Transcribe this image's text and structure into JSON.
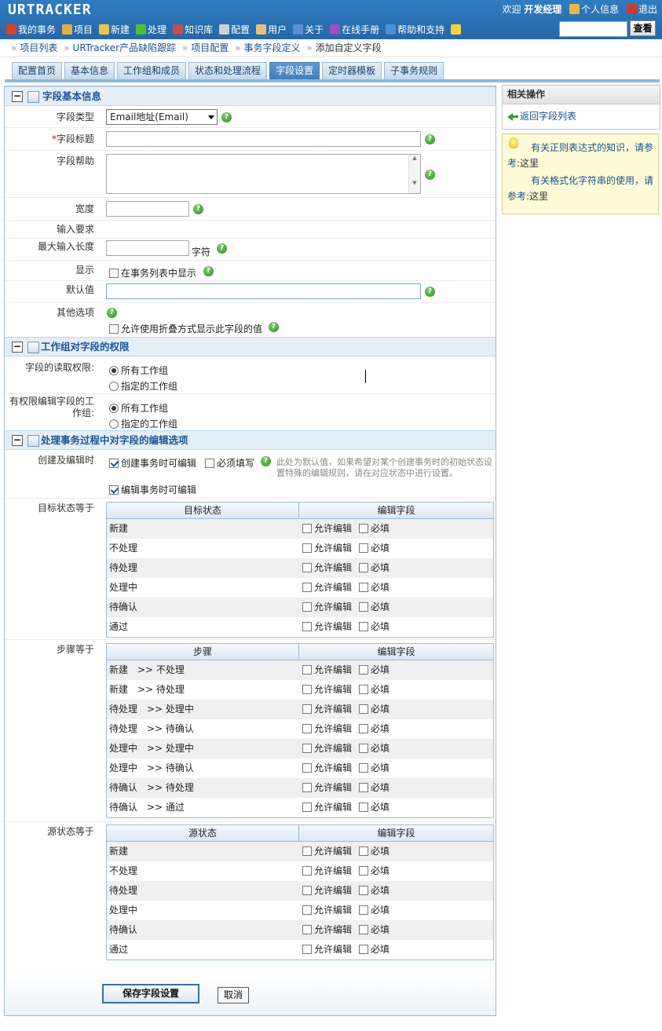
{
  "app": {
    "logo": "URTRACKER",
    "welcome_prefix": "欢迎",
    "user_name": "开发经理",
    "personal_info": "个人信息",
    "logout": "退出"
  },
  "menu": [
    {
      "label": "我的事务",
      "icon": "home-icon",
      "color": "#d9412b"
    },
    {
      "label": "项目",
      "icon": "database-icon",
      "color": "#e0b040"
    },
    {
      "label": "新建",
      "icon": "new-item-icon",
      "color": "#e8c64a"
    },
    {
      "label": "处理",
      "icon": "check-icon",
      "color": "#4cbf3a"
    },
    {
      "label": "知识库",
      "icon": "books-icon",
      "color": "#c0504d"
    },
    {
      "label": "配置",
      "icon": "gear-icon",
      "color": "#d0d0d0"
    },
    {
      "label": "用户",
      "icon": "users-icon",
      "color": "#e8c080"
    },
    {
      "label": "关于",
      "icon": "info-icon",
      "color": "#5a8fd6"
    },
    {
      "label": "在线手册",
      "icon": "manual-icon",
      "color": "#9b4fc2"
    },
    {
      "label": "帮助和支持",
      "icon": "help-icon",
      "color": "#4a8fe0"
    },
    {
      "label": "",
      "icon": "star-add-icon",
      "color": "#f2d33a"
    }
  ],
  "search": {
    "button": "查看",
    "value": ""
  },
  "breadcrumb": [
    "项目列表",
    "URTracker产品缺陷跟踪",
    "项目配置",
    "事务字段定义",
    "添加自定义字段"
  ],
  "tabs": [
    "配置首页",
    "基本信息",
    "工作组和成员",
    "状态和处理流程",
    "字段设置",
    "定时器模板",
    "子事务规则"
  ],
  "active_tab": 4,
  "section1": {
    "title": "字段基本信息",
    "field_type_label": "字段类型",
    "field_type_value": "Email地址(Email)",
    "field_title_label": "字段标题",
    "field_help_label": "字段帮助",
    "width_label": "宽度",
    "input_req_label": "输入要求",
    "max_len_label": "最大输入长度",
    "max_len_unit": "字符",
    "display_label": "显示",
    "display_option": "在事务列表中显示",
    "default_label": "默认值",
    "other_label": "其他选项",
    "other_option": "允许使用折叠方式显示此字段的值"
  },
  "section2": {
    "title": "工作组对字段的权限",
    "read_label": "字段的读取权限:",
    "edit_label": "有权限编辑字段的工作组:",
    "all_groups": "所有工作组",
    "specified_groups": "指定的工作组"
  },
  "section3": {
    "title": "处理事务过程中对字段的编辑选项",
    "create_edit_label": "创建及编辑时",
    "editable_on_create": "创建事务时可编辑",
    "required": "必须填写",
    "note": "此处为默认值，如果希望对某个创建事务时的初始状态设置特殊的编辑规则，请在对应状态中进行设置。",
    "editable_on_edit": "编辑事务时可编辑",
    "allow_edit": "允许编辑",
    "must_fill": "必填",
    "edit_field_header": "编辑字段",
    "target_label": "目标状态等于",
    "target_header": "目标状态",
    "target_rows": [
      "新建",
      "不处理",
      "待处理",
      "处理中",
      "待确认",
      "通过"
    ],
    "step_label": "步骤等于",
    "step_header": "步骤",
    "step_rows": [
      "新建　>> 不处理",
      "新建　>> 待处理",
      "待处理　>> 处理中",
      "待处理　>> 待确认",
      "处理中　>> 处理中",
      "处理中　>> 待确认",
      "待确认　>> 待处理",
      "待确认　>> 通过"
    ],
    "source_label": "源状态等于",
    "source_header": "源状态",
    "source_rows": [
      "新建",
      "不处理",
      "待处理",
      "处理中",
      "待确认",
      "通过"
    ]
  },
  "footer": {
    "save": "保存字段设置",
    "cancel": "取消"
  },
  "sidebar": {
    "title": "相关操作",
    "back_link": "返回字段列表",
    "tip1": "有关正则表达式的知识，请参考:",
    "tip1_link": "这里",
    "tip2": "有关格式化字符串的使用，请参考:",
    "tip2_link": "这里"
  }
}
